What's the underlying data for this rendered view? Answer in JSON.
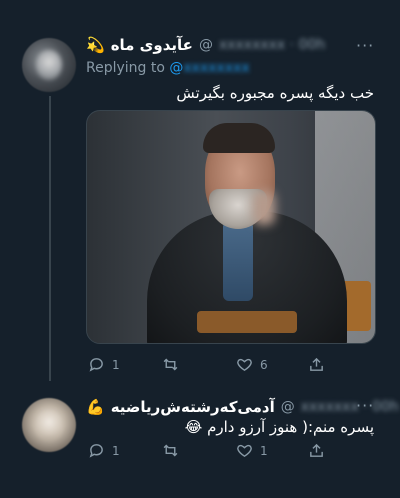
{
  "colors": {
    "background": "#15202b",
    "secondary_text": "#8899a6",
    "accent": "#1d9bf0",
    "divider": "#38444d"
  },
  "tweet1": {
    "name": "عآیدوی ماه",
    "name_emoji": "💫",
    "handle": "@",
    "more": "···",
    "replying_label": "Replying to",
    "replying_handle": "@",
    "text": "خب دیگه پسره مجبوره بگیرتش",
    "media_icon": "photo-of-smiling-man",
    "actions": {
      "reply_count": "1",
      "retweet_count": "",
      "like_count": "6"
    }
  },
  "tweet2": {
    "name": "آدمی‌که‌رشته‌ش‌ریاضیه",
    "name_emoji": "💪",
    "handle": "@",
    "more": "···",
    "text": "پسره منم:( هنوز آرزو دارم",
    "text_emoji": "😂",
    "actions": {
      "reply_count": "1",
      "retweet_count": "",
      "like_count": "1"
    }
  }
}
